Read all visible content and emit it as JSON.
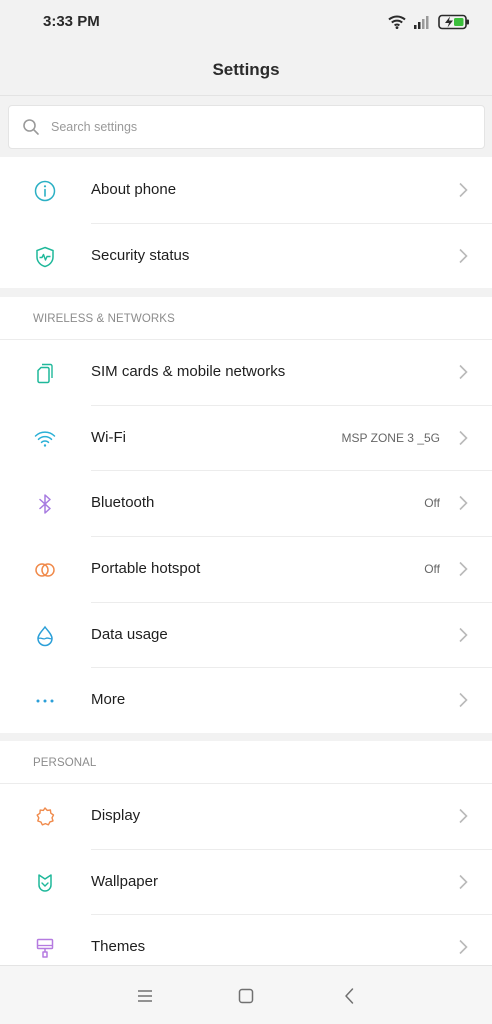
{
  "status_bar": {
    "time": "3:33 PM"
  },
  "app_bar": {
    "title": "Settings"
  },
  "search": {
    "placeholder": "Search settings"
  },
  "groups": [
    {
      "header": "",
      "items": [
        {
          "label": "About phone",
          "value": "",
          "icon": "info-icon",
          "color": "#2bb0c4"
        },
        {
          "label": "Security status",
          "value": "",
          "icon": "shield-pulse-icon",
          "color": "#1fb89a"
        }
      ]
    },
    {
      "header": "WIRELESS & NETWORKS",
      "items": [
        {
          "label": "SIM cards & mobile networks",
          "value": "",
          "icon": "sim-card-icon",
          "color": "#1fb89a"
        },
        {
          "label": "Wi-Fi",
          "value": "MSP ZONE 3 _5G",
          "icon": "wifi-icon",
          "color": "#2bb0d6"
        },
        {
          "label": "Bluetooth",
          "value": "Off",
          "icon": "bluetooth-icon",
          "color": "#a77be0"
        },
        {
          "label": "Portable hotspot",
          "value": "Off",
          "icon": "hotspot-icon",
          "color": "#f08a4b"
        },
        {
          "label": "Data usage",
          "value": "",
          "icon": "data-drop-icon",
          "color": "#2b9fd8"
        },
        {
          "label": "More",
          "value": "",
          "icon": "more-dots-icon",
          "color": "#2b9fd8"
        }
      ]
    },
    {
      "header": "PERSONAL",
      "items": [
        {
          "label": "Display",
          "value": "",
          "icon": "display-sun-icon",
          "color": "#f08a4b"
        },
        {
          "label": "Wallpaper",
          "value": "",
          "icon": "wallpaper-icon",
          "color": "#1fb89a"
        },
        {
          "label": "Themes",
          "value": "",
          "icon": "themes-brush-icon",
          "color": "#b57be0"
        }
      ]
    }
  ],
  "colors": {
    "background": "#f2f2f2",
    "battery_charge": "#3bbf3b",
    "chevron": "#b9b9b9"
  }
}
